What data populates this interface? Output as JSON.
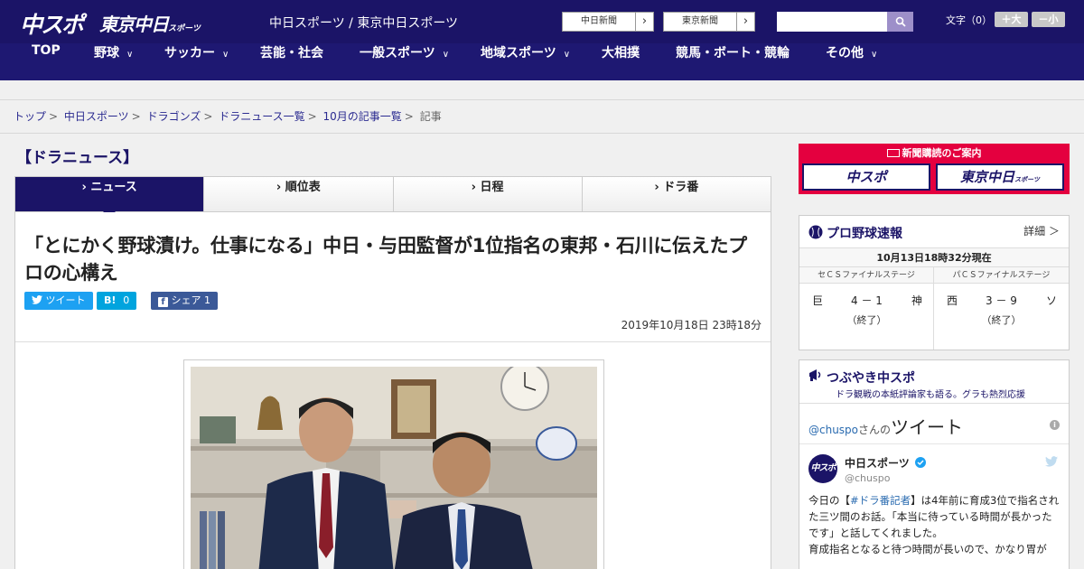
{
  "header": {
    "logo_chuspo": "中スポ",
    "logo_tokyo": "東京中日",
    "logo_tokyo_sub": "スポーツ",
    "site_name": "中日スポーツ / 東京中日スポーツ",
    "paper_links": [
      {
        "label": "中日新聞",
        "arrow": "›"
      },
      {
        "label": "東京新聞",
        "arrow": "›"
      }
    ],
    "font_size_label": "文字（0）",
    "font_larger": "＋大",
    "font_smaller": "－小"
  },
  "nav": {
    "items": [
      {
        "label": "TOP",
        "chev": ""
      },
      {
        "label": "野球",
        "chev": "∨"
      },
      {
        "label": "サッカー",
        "chev": "∨"
      },
      {
        "label": "芸能・社会",
        "chev": ""
      },
      {
        "label": "一般スポーツ",
        "chev": "∨"
      },
      {
        "label": "地域スポーツ",
        "chev": "∨"
      },
      {
        "label": "大相撲",
        "chev": ""
      },
      {
        "label": "競馬・ボート・競輪",
        "chev": ""
      },
      {
        "label": "その他",
        "chev": "∨"
      }
    ]
  },
  "breadcrumb": {
    "items": [
      "トップ",
      "中日スポーツ",
      "ドラゴンズ",
      "ドラニュース一覧",
      "10月の記事一覧"
    ],
    "current": "記事",
    "separator": ">"
  },
  "section": {
    "title": "【ドラニュース】",
    "tabs": [
      "› ニュース",
      "› 順位表",
      "› 日程",
      "› ドラ番"
    ]
  },
  "article": {
    "headline": "「とにかく野球漬け。仕事になる」中日・与田監督が1位指名の東邦・石川に伝えたプロの心構え",
    "share": {
      "tweet": "ツイート",
      "hatena_icon": "B!",
      "hatena_count": "0",
      "facebook": "シェア",
      "facebook_count": "1"
    },
    "date": "2019年10月18日 23時18分"
  },
  "sidebar": {
    "promo": {
      "title": "新聞購読のご案内",
      "chuspo": "中スポ",
      "tokyo": "東京中日",
      "tokyo_sub": "スポーツ"
    },
    "scores": {
      "title": "プロ野球速報",
      "detail": "詳細 ＞",
      "time": "10月13日18時32分現在",
      "games": [
        {
          "stage": "セＣＳファイナルステージ",
          "home": "巨",
          "away": "神",
          "score": "4 － 1",
          "status": "（終了）"
        },
        {
          "stage": "パＣＳファイナルステージ",
          "home": "西",
          "away": "ソ",
          "score": "3 － 9",
          "status": "（終了）"
        }
      ]
    },
    "twitter": {
      "title": "つぶやき中スポ",
      "subtitle": "ドラ観戦の本紙評論家も語る。グラも熱烈応援",
      "handle": "@chuspo",
      "handle_suffix": "さんの",
      "handle_big": "ツイート",
      "avatar_text": "中スポ",
      "name": "中日スポーツ",
      "user": "@chuspo",
      "text_pre": "今日の【",
      "text_tag": "#ドラ番記者",
      "text_post": "】は4年前に育成3位で指名された三ツ間のお話。「本当に待っている時間が長かったです」と話してくれました。",
      "text_more": "育成指名となると待つ時間が長いので、かなり胃が"
    }
  }
}
